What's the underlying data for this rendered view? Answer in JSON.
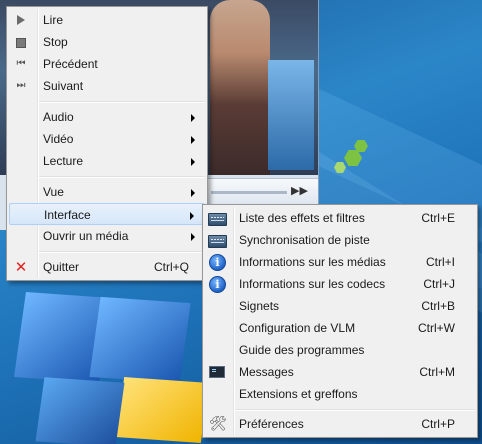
{
  "main_menu": {
    "items": [
      {
        "label": "Lire",
        "icon": "play-icon"
      },
      {
        "label": "Stop",
        "icon": "stop-icon"
      },
      {
        "label": "Précédent",
        "icon": "previous-icon"
      },
      {
        "label": "Suivant",
        "icon": "next-icon"
      },
      {
        "label": "Audio",
        "submenu": true
      },
      {
        "label": "Vidéo",
        "submenu": true
      },
      {
        "label": "Lecture",
        "submenu": true
      },
      {
        "label": "Vue",
        "submenu": true
      },
      {
        "label": "Interface",
        "submenu": true,
        "highlighted": true
      },
      {
        "label": "Ouvrir un média",
        "submenu": true
      },
      {
        "label": "Quitter",
        "shortcut": "Ctrl+Q",
        "icon": "quit-icon"
      }
    ]
  },
  "interface_submenu": {
    "items": [
      {
        "label": "Liste des effets et filtres",
        "shortcut": "Ctrl+E",
        "icon": "effects-icon"
      },
      {
        "label": "Synchronisation de piste",
        "shortcut": "",
        "icon": "sync-icon"
      },
      {
        "label": "Informations sur les médias",
        "shortcut": "Ctrl+I",
        "icon": "info-icon"
      },
      {
        "label": "Informations sur les codecs",
        "shortcut": "Ctrl+J",
        "icon": "info-icon"
      },
      {
        "label": "Signets",
        "shortcut": "Ctrl+B"
      },
      {
        "label": "Configuration de VLM",
        "shortcut": "Ctrl+W"
      },
      {
        "label": "Guide des programmes",
        "shortcut": ""
      },
      {
        "label": "Messages",
        "shortcut": "Ctrl+M",
        "icon": "console-icon"
      },
      {
        "label": "Extensions et greffons",
        "shortcut": ""
      },
      {
        "label": "Préférences",
        "shortcut": "Ctrl+P",
        "icon": "tools-icon"
      }
    ]
  },
  "colors": {
    "menu_bg": "#f0f0f0",
    "highlight": "#d6e6f9",
    "highlight_border": "#aecff7",
    "quit_icon": "#e02424",
    "info_icon": "#1f63c8"
  }
}
